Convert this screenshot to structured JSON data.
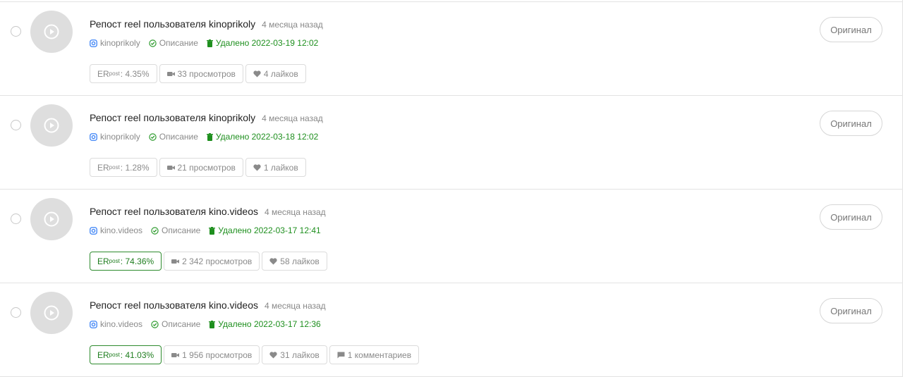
{
  "colors": {
    "accent_green": "#1e8f1e",
    "instagram_blue": "#3b82f6",
    "border": "#e3e3e3"
  },
  "posts": [
    {
      "title": "Репост reel пользователя kinoprikoly",
      "ago": "4 месяца назад",
      "account": "kinoprikoly",
      "description_label": "Описание",
      "deleted": "Удалено 2022-03-19 12:02",
      "er_label": "ER",
      "er_sub": "post",
      "er_value": ": 4.35%",
      "er_highlight": false,
      "views": "33 просмотров",
      "likes": "4 лайков",
      "comments": null,
      "original_button": "Оригинал"
    },
    {
      "title": "Репост reel пользователя kinoprikoly",
      "ago": "4 месяца назад",
      "account": "kinoprikoly",
      "description_label": "Описание",
      "deleted": "Удалено 2022-03-18 12:02",
      "er_label": "ER",
      "er_sub": "post",
      "er_value": ": 1.28%",
      "er_highlight": false,
      "views": "21 просмотров",
      "likes": "1 лайков",
      "comments": null,
      "original_button": "Оригинал"
    },
    {
      "title": "Репост reel пользователя kino.videos",
      "ago": "4 месяца назад",
      "account": "kino.videos",
      "description_label": "Описание",
      "deleted": "Удалено 2022-03-17 12:41",
      "er_label": "ER",
      "er_sub": "post",
      "er_value": ": 74.36%",
      "er_highlight": true,
      "views": "2 342 просмотров",
      "likes": "58 лайков",
      "comments": null,
      "original_button": "Оригинал"
    },
    {
      "title": "Репост reel пользователя kino.videos",
      "ago": "4 месяца назад",
      "account": "kino.videos",
      "description_label": "Описание",
      "deleted": "Удалено 2022-03-17 12:36",
      "er_label": "ER",
      "er_sub": "post",
      "er_value": ": 41.03%",
      "er_highlight": true,
      "views": "1 956 просмотров",
      "likes": "31 лайков",
      "comments": "1 комментариев",
      "original_button": "Оригинал"
    }
  ]
}
